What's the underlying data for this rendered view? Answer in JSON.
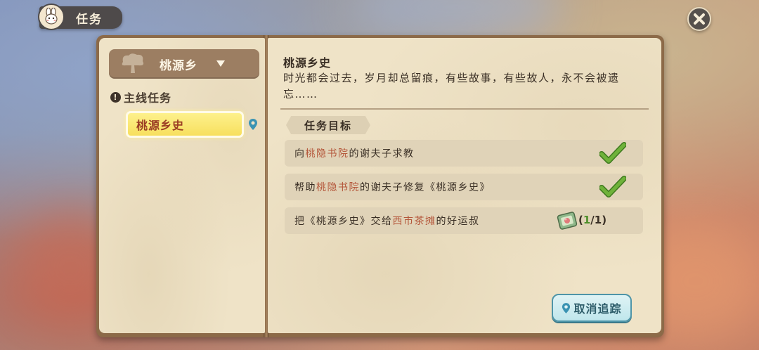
{
  "header": {
    "title": "任务",
    "icons": {
      "avatar": "rabbit-icon",
      "close": "close-icon"
    }
  },
  "sidebar": {
    "region": "桃源乡",
    "section_label": "主线任务",
    "quests": [
      {
        "label": "桃源乡史",
        "selected": true
      }
    ]
  },
  "detail": {
    "title": "桃源乡史",
    "description": "时光都会过去，岁月却总留痕，有些故事，有些故人，永不会被遗忘……",
    "objectives_label": "任务目标",
    "objectives": [
      {
        "prefix": "向",
        "place": "桃隐书院",
        "suffix": "的谢夫子求教",
        "done": true
      },
      {
        "prefix": "帮助",
        "place": "桃隐书院",
        "suffix": "的谢夫子修复《桃源乡史》",
        "done": true
      },
      {
        "prefix": "把《桃源乡史》交给",
        "place": "西市茶摊",
        "suffix": "的好运叔",
        "done": false,
        "progress_current": "1",
        "progress_total": "1"
      }
    ],
    "cancel_button": "取消追踪"
  },
  "colors": {
    "highlight": "#b4563a",
    "check": "#5a9a2c",
    "selected_quest": "#f7df5e",
    "button_border": "#4f95a8"
  }
}
